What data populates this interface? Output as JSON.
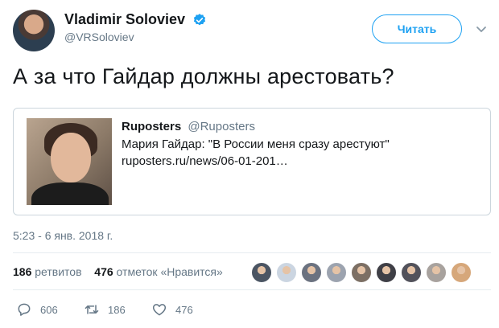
{
  "author": {
    "display_name": "Vladimir Soloviev",
    "handle": "@VRSoloviev",
    "verified_icon": "verified-badge-icon",
    "verified_color": "#1da1f2"
  },
  "follow_button_label": "Читать",
  "tweet": {
    "text": "А за что Гайдар должны арестовать?",
    "timestamp": "5:23 - 6 янв. 2018 г."
  },
  "quote": {
    "name": "Ruposters",
    "handle": "@Ruposters",
    "line1": "Мария Гайдар: \"В России меня сразу арестуют\"",
    "line2": "ruposters.ru/news/06-01-201…"
  },
  "stats": {
    "retweets_count": "186",
    "retweets_label": "ретвитов",
    "likes_count": "476",
    "likes_label": "отметок «Нравится»"
  },
  "liker_avatar_colors": [
    "#4b5563",
    "#cbd5e1",
    "#6b7280",
    "#9ca3af",
    "#7c6f64",
    "#3f3f46",
    "#52525b",
    "#a8a29e",
    "#d6a77a"
  ],
  "actions": {
    "reply_icon": "reply-icon",
    "reply_count": "606",
    "retweet_icon": "retweet-icon",
    "retweet_count": "186",
    "like_icon": "heart-icon",
    "like_count": "476"
  },
  "colors": {
    "accent": "#1da1f2",
    "secondary_text": "#657786",
    "primary_text": "#14171a",
    "border": "#ccd6dd"
  }
}
